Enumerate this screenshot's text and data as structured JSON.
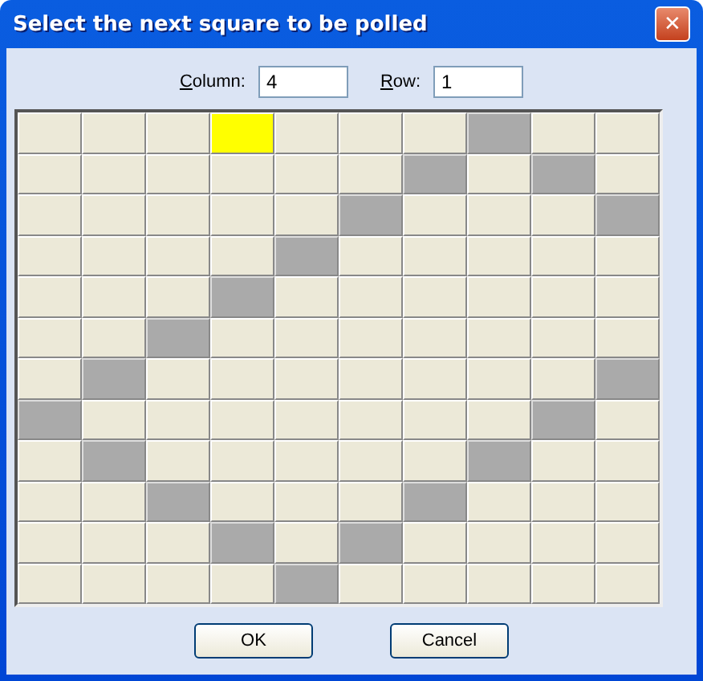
{
  "window": {
    "title": "Select the next square to be polled",
    "close": "✕"
  },
  "fields": [
    {
      "label": "Column:",
      "value": "4"
    },
    {
      "label": "Row:",
      "value": "1"
    }
  ],
  "grid": {
    "rows": [
      {
        "cells": [
          {
            "filled": false,
            "selected": false
          },
          {
            "filled": false,
            "selected": false
          },
          {
            "filled": false,
            "selected": false
          },
          {
            "filled": false,
            "selected": true
          },
          {
            "filled": false,
            "selected": false
          },
          {
            "filled": false,
            "selected": false
          },
          {
            "filled": false,
            "selected": false
          },
          {
            "filled": true,
            "selected": false
          },
          {
            "filled": false,
            "selected": false
          },
          {
            "filled": false,
            "selected": false
          }
        ]
      },
      {
        "cells": [
          {
            "filled": false,
            "selected": false
          },
          {
            "filled": false,
            "selected": false
          },
          {
            "filled": false,
            "selected": false
          },
          {
            "filled": false,
            "selected": false
          },
          {
            "filled": false,
            "selected": false
          },
          {
            "filled": false,
            "selected": false
          },
          {
            "filled": true,
            "selected": false
          },
          {
            "filled": false,
            "selected": false
          },
          {
            "filled": true,
            "selected": false
          },
          {
            "filled": false,
            "selected": false
          }
        ]
      },
      {
        "cells": [
          {
            "filled": false,
            "selected": false
          },
          {
            "filled": false,
            "selected": false
          },
          {
            "filled": false,
            "selected": false
          },
          {
            "filled": false,
            "selected": false
          },
          {
            "filled": false,
            "selected": false
          },
          {
            "filled": true,
            "selected": false
          },
          {
            "filled": false,
            "selected": false
          },
          {
            "filled": false,
            "selected": false
          },
          {
            "filled": false,
            "selected": false
          },
          {
            "filled": true,
            "selected": false
          }
        ]
      },
      {
        "cells": [
          {
            "filled": false,
            "selected": false
          },
          {
            "filled": false,
            "selected": false
          },
          {
            "filled": false,
            "selected": false
          },
          {
            "filled": false,
            "selected": false
          },
          {
            "filled": true,
            "selected": false
          },
          {
            "filled": false,
            "selected": false
          },
          {
            "filled": false,
            "selected": false
          },
          {
            "filled": false,
            "selected": false
          },
          {
            "filled": false,
            "selected": false
          },
          {
            "filled": false,
            "selected": false
          }
        ]
      },
      {
        "cells": [
          {
            "filled": false,
            "selected": false
          },
          {
            "filled": false,
            "selected": false
          },
          {
            "filled": false,
            "selected": false
          },
          {
            "filled": true,
            "selected": false
          },
          {
            "filled": false,
            "selected": false
          },
          {
            "filled": false,
            "selected": false
          },
          {
            "filled": false,
            "selected": false
          },
          {
            "filled": false,
            "selected": false
          },
          {
            "filled": false,
            "selected": false
          },
          {
            "filled": false,
            "selected": false
          }
        ]
      },
      {
        "cells": [
          {
            "filled": false,
            "selected": false
          },
          {
            "filled": false,
            "selected": false
          },
          {
            "filled": true,
            "selected": false
          },
          {
            "filled": false,
            "selected": false
          },
          {
            "filled": false,
            "selected": false
          },
          {
            "filled": false,
            "selected": false
          },
          {
            "filled": false,
            "selected": false
          },
          {
            "filled": false,
            "selected": false
          },
          {
            "filled": false,
            "selected": false
          },
          {
            "filled": false,
            "selected": false
          }
        ]
      },
      {
        "cells": [
          {
            "filled": false,
            "selected": false
          },
          {
            "filled": true,
            "selected": false
          },
          {
            "filled": false,
            "selected": false
          },
          {
            "filled": false,
            "selected": false
          },
          {
            "filled": false,
            "selected": false
          },
          {
            "filled": false,
            "selected": false
          },
          {
            "filled": false,
            "selected": false
          },
          {
            "filled": false,
            "selected": false
          },
          {
            "filled": false,
            "selected": false
          },
          {
            "filled": true,
            "selected": false
          }
        ]
      },
      {
        "cells": [
          {
            "filled": true,
            "selected": false
          },
          {
            "filled": false,
            "selected": false
          },
          {
            "filled": false,
            "selected": false
          },
          {
            "filled": false,
            "selected": false
          },
          {
            "filled": false,
            "selected": false
          },
          {
            "filled": false,
            "selected": false
          },
          {
            "filled": false,
            "selected": false
          },
          {
            "filled": false,
            "selected": false
          },
          {
            "filled": true,
            "selected": false
          },
          {
            "filled": false,
            "selected": false
          }
        ]
      },
      {
        "cells": [
          {
            "filled": false,
            "selected": false
          },
          {
            "filled": true,
            "selected": false
          },
          {
            "filled": false,
            "selected": false
          },
          {
            "filled": false,
            "selected": false
          },
          {
            "filled": false,
            "selected": false
          },
          {
            "filled": false,
            "selected": false
          },
          {
            "filled": false,
            "selected": false
          },
          {
            "filled": true,
            "selected": false
          },
          {
            "filled": false,
            "selected": false
          },
          {
            "filled": false,
            "selected": false
          }
        ]
      },
      {
        "cells": [
          {
            "filled": false,
            "selected": false
          },
          {
            "filled": false,
            "selected": false
          },
          {
            "filled": true,
            "selected": false
          },
          {
            "filled": false,
            "selected": false
          },
          {
            "filled": false,
            "selected": false
          },
          {
            "filled": false,
            "selected": false
          },
          {
            "filled": true,
            "selected": false
          },
          {
            "filled": false,
            "selected": false
          },
          {
            "filled": false,
            "selected": false
          },
          {
            "filled": false,
            "selected": false
          }
        ]
      },
      {
        "cells": [
          {
            "filled": false,
            "selected": false
          },
          {
            "filled": false,
            "selected": false
          },
          {
            "filled": false,
            "selected": false
          },
          {
            "filled": true,
            "selected": false
          },
          {
            "filled": false,
            "selected": false
          },
          {
            "filled": true,
            "selected": false
          },
          {
            "filled": false,
            "selected": false
          },
          {
            "filled": false,
            "selected": false
          },
          {
            "filled": false,
            "selected": false
          },
          {
            "filled": false,
            "selected": false
          }
        ]
      },
      {
        "cells": [
          {
            "filled": false,
            "selected": false
          },
          {
            "filled": false,
            "selected": false
          },
          {
            "filled": false,
            "selected": false
          },
          {
            "filled": false,
            "selected": false
          },
          {
            "filled": true,
            "selected": false
          },
          {
            "filled": false,
            "selected": false
          },
          {
            "filled": false,
            "selected": false
          },
          {
            "filled": false,
            "selected": false
          },
          {
            "filled": false,
            "selected": false
          },
          {
            "filled": false,
            "selected": false
          }
        ]
      }
    ]
  },
  "buttons": [
    "OK",
    "Cancel"
  ]
}
